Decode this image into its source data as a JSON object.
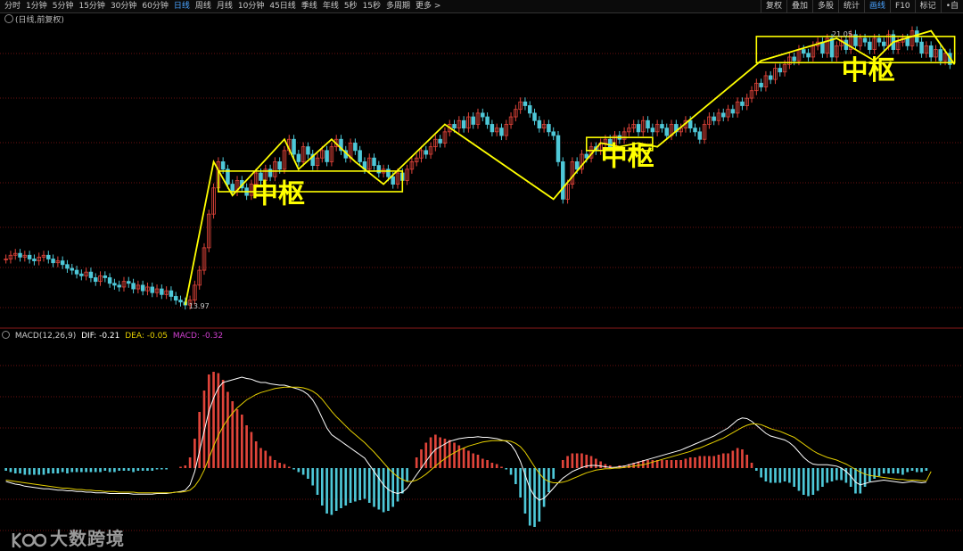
{
  "toolbar": {
    "periods": [
      "分时",
      "1分钟",
      "5分钟",
      "15分钟",
      "30分钟",
      "60分钟",
      "日线",
      "周线",
      "月线",
      "10分钟",
      "45日线",
      "季线",
      "年线",
      "5秒",
      "15秒",
      "多周期",
      "更多 >"
    ],
    "active_period": "日线",
    "right_items": [
      "复权",
      "叠加",
      "多股",
      "统计",
      "画线",
      "F10",
      "标记",
      "•自"
    ],
    "right_active": "画线"
  },
  "price_panel": {
    "label": "(日线,前复权)"
  },
  "macd_header": {
    "name": "MACD(12,26,9)",
    "dif": "DIF: -0.21",
    "dea": "DEA: -0.05",
    "macd": "MACD: -0.32"
  },
  "annotations": {
    "zhongshu_labels": [
      "中枢",
      "中枢",
      "中枢"
    ]
  },
  "watermark": {
    "text": "大数跨境"
  },
  "colors": {
    "up": "#e0443a",
    "down": "#4ec8d8",
    "annotation": "#ffff00",
    "dif": "#ffffff",
    "dea": "#e6d000",
    "macd_text": "#d040d0",
    "grid": "#6a1010"
  },
  "chart_data": {
    "type": "candlestick",
    "low_label": "13.97",
    "high_label": "21.05",
    "price_range": [
      13.4,
      21.6
    ],
    "close": [
      15.2,
      15.3,
      15.35,
      15.25,
      15.3,
      15.2,
      15.15,
      15.25,
      15.3,
      15.2,
      15.1,
      15.15,
      15.05,
      14.95,
      14.9,
      14.8,
      14.75,
      14.85,
      14.7,
      14.6,
      14.75,
      14.7,
      14.55,
      14.5,
      14.45,
      14.6,
      14.55,
      14.4,
      14.5,
      14.35,
      14.45,
      14.3,
      14.4,
      14.25,
      14.35,
      14.2,
      14.1,
      14.05,
      13.97,
      14.1,
      14.5,
      14.9,
      15.5,
      16.4,
      17.1,
      17.8,
      17.6,
      17.2,
      17.0,
      17.3,
      17.1,
      16.9,
      17.2,
      17.5,
      17.3,
      17.6,
      17.4,
      17.8,
      17.6,
      18.1,
      18.4,
      18.0,
      17.8,
      18.2,
      18.0,
      17.7,
      17.9,
      18.1,
      17.8,
      18.2,
      18.4,
      18.1,
      17.9,
      18.3,
      18.1,
      17.8,
      17.6,
      17.9,
      17.7,
      17.5,
      17.6,
      17.4,
      17.2,
      17.5,
      17.3,
      17.6,
      17.8,
      17.9,
      18.1,
      18.0,
      18.2,
      18.4,
      18.3,
      18.6,
      18.8,
      18.7,
      18.9,
      18.7,
      19.0,
      18.8,
      19.1,
      19.0,
      18.8,
      18.6,
      18.7,
      18.5,
      18.8,
      19.0,
      19.2,
      19.4,
      19.3,
      19.1,
      18.9,
      18.7,
      18.8,
      18.6,
      18.5,
      17.8,
      16.8,
      17.2,
      17.8,
      17.6,
      18.0,
      17.9,
      18.2,
      18.1,
      18.3,
      18.4,
      18.2,
      18.5,
      18.4,
      18.6,
      18.7,
      18.8,
      18.6,
      18.9,
      18.7,
      18.6,
      18.8,
      18.7,
      18.5,
      18.8,
      18.6,
      18.7,
      18.9,
      18.7,
      18.6,
      18.4,
      18.8,
      19.0,
      18.9,
      19.1,
      19.0,
      19.2,
      19.1,
      19.4,
      19.3,
      19.5,
      19.7,
      19.9,
      19.8,
      20.1,
      20.0,
      20.3,
      20.2,
      20.4,
      20.6,
      20.5,
      20.8,
      20.7,
      20.6,
      20.9,
      21.0,
      20.7,
      21.1,
      20.6,
      20.9,
      21.05,
      20.8,
      21.2,
      20.9,
      21.1,
      21.0,
      20.8,
      21.1,
      21.0,
      20.9,
      21.2,
      20.8,
      21.0,
      21.1,
      20.9,
      21.3,
      21.0,
      20.7,
      20.9,
      20.6,
      20.8,
      20.5,
      20.7,
      20.4
    ],
    "macd": {
      "dif": [
        -0.2,
        -0.22,
        -0.24,
        -0.25,
        -0.27,
        -0.28,
        -0.29,
        -0.3,
        -0.31,
        -0.31,
        -0.32,
        -0.33,
        -0.33,
        -0.34,
        -0.34,
        -0.35,
        -0.35,
        -0.36,
        -0.36,
        -0.37,
        -0.37,
        -0.37,
        -0.38,
        -0.38,
        -0.38,
        -0.38,
        -0.38,
        -0.39,
        -0.39,
        -0.39,
        -0.39,
        -0.39,
        -0.38,
        -0.38,
        -0.38,
        -0.37,
        -0.36,
        -0.35,
        -0.33,
        -0.25,
        -0.05,
        0.25,
        0.55,
        0.85,
        1.05,
        1.2,
        1.28,
        1.3,
        1.32,
        1.34,
        1.36,
        1.34,
        1.33,
        1.3,
        1.28,
        1.28,
        1.26,
        1.25,
        1.24,
        1.24,
        1.22,
        1.2,
        1.18,
        1.15,
        1.1,
        1.02,
        0.9,
        0.75,
        0.6,
        0.5,
        0.45,
        0.4,
        0.35,
        0.3,
        0.25,
        0.2,
        0.15,
        0.05,
        -0.05,
        -0.15,
        -0.25,
        -0.32,
        -0.36,
        -0.38,
        -0.36,
        -0.3,
        -0.2,
        -0.1,
        0.0,
        0.1,
        0.2,
        0.28,
        0.32,
        0.36,
        0.4,
        0.42,
        0.44,
        0.45,
        0.46,
        0.46,
        0.47,
        0.46,
        0.46,
        0.45,
        0.44,
        0.42,
        0.4,
        0.35,
        0.25,
        0.1,
        -0.1,
        -0.3,
        -0.42,
        -0.48,
        -0.45,
        -0.38,
        -0.3,
        -0.22,
        -0.15,
        -0.1,
        -0.05,
        -0.02,
        0.01,
        0.03,
        0.04,
        0.04,
        0.03,
        0.02,
        0.01,
        0.01,
        0.02,
        0.03,
        0.05,
        0.07,
        0.09,
        0.11,
        0.13,
        0.15,
        0.17,
        0.19,
        0.21,
        0.23,
        0.25,
        0.27,
        0.3,
        0.33,
        0.36,
        0.39,
        0.42,
        0.45,
        0.48,
        0.52,
        0.56,
        0.6,
        0.66,
        0.72,
        0.75,
        0.74,
        0.7,
        0.64,
        0.58,
        0.52,
        0.48,
        0.46,
        0.44,
        0.42,
        0.38,
        0.32,
        0.24,
        0.16,
        0.1,
        0.06,
        0.05,
        0.05,
        0.05,
        0.04,
        0.03,
        0.0,
        -0.05,
        -0.12,
        -0.21,
        -0.25,
        -0.23,
        -0.21,
        -0.2,
        -0.19,
        -0.18,
        -0.19,
        -0.2,
        -0.21,
        -0.22,
        -0.21,
        -0.2,
        -0.21,
        -0.22,
        -0.21
      ],
      "dea": [
        -0.18,
        -0.19,
        -0.2,
        -0.21,
        -0.22,
        -0.23,
        -0.24,
        -0.25,
        -0.26,
        -0.27,
        -0.28,
        -0.29,
        -0.3,
        -0.3,
        -0.31,
        -0.32,
        -0.32,
        -0.33,
        -0.33,
        -0.34,
        -0.34,
        -0.35,
        -0.35,
        -0.35,
        -0.36,
        -0.36,
        -0.36,
        -0.36,
        -0.37,
        -0.37,
        -0.37,
        -0.37,
        -0.37,
        -0.37,
        -0.37,
        -0.37,
        -0.36,
        -0.36,
        -0.35,
        -0.33,
        -0.27,
        -0.17,
        -0.03,
        0.15,
        0.33,
        0.49,
        0.62,
        0.73,
        0.82,
        0.9,
        0.96,
        1.02,
        1.06,
        1.1,
        1.13,
        1.15,
        1.17,
        1.19,
        1.2,
        1.21,
        1.21,
        1.21,
        1.21,
        1.2,
        1.18,
        1.15,
        1.1,
        1.03,
        0.94,
        0.85,
        0.77,
        0.7,
        0.63,
        0.56,
        0.5,
        0.44,
        0.38,
        0.31,
        0.24,
        0.16,
        0.08,
        0.0,
        -0.07,
        -0.13,
        -0.17,
        -0.2,
        -0.2,
        -0.18,
        -0.14,
        -0.09,
        -0.03,
        0.03,
        0.09,
        0.14,
        0.19,
        0.23,
        0.27,
        0.3,
        0.33,
        0.35,
        0.37,
        0.39,
        0.4,
        0.41,
        0.41,
        0.41,
        0.41,
        0.4,
        0.37,
        0.32,
        0.24,
        0.13,
        0.02,
        -0.08,
        -0.16,
        -0.2,
        -0.22,
        -0.22,
        -0.21,
        -0.19,
        -0.16,
        -0.13,
        -0.1,
        -0.07,
        -0.05,
        -0.03,
        -0.02,
        -0.01,
        -0.01,
        0.0,
        0.0,
        0.01,
        0.02,
        0.03,
        0.04,
        0.05,
        0.07,
        0.09,
        0.11,
        0.13,
        0.15,
        0.17,
        0.19,
        0.21,
        0.23,
        0.25,
        0.28,
        0.3,
        0.33,
        0.36,
        0.39,
        0.42,
        0.45,
        0.49,
        0.53,
        0.57,
        0.61,
        0.64,
        0.66,
        0.66,
        0.65,
        0.62,
        0.59,
        0.57,
        0.55,
        0.52,
        0.49,
        0.46,
        0.41,
        0.36,
        0.31,
        0.26,
        0.22,
        0.19,
        0.16,
        0.14,
        0.12,
        0.09,
        0.06,
        0.02,
        -0.02,
        -0.06,
        -0.09,
        -0.11,
        -0.12,
        -0.13,
        -0.14,
        -0.15,
        -0.16,
        -0.17,
        -0.17,
        -0.18,
        -0.18,
        -0.18,
        -0.19,
        -0.19,
        -0.05
      ]
    }
  }
}
